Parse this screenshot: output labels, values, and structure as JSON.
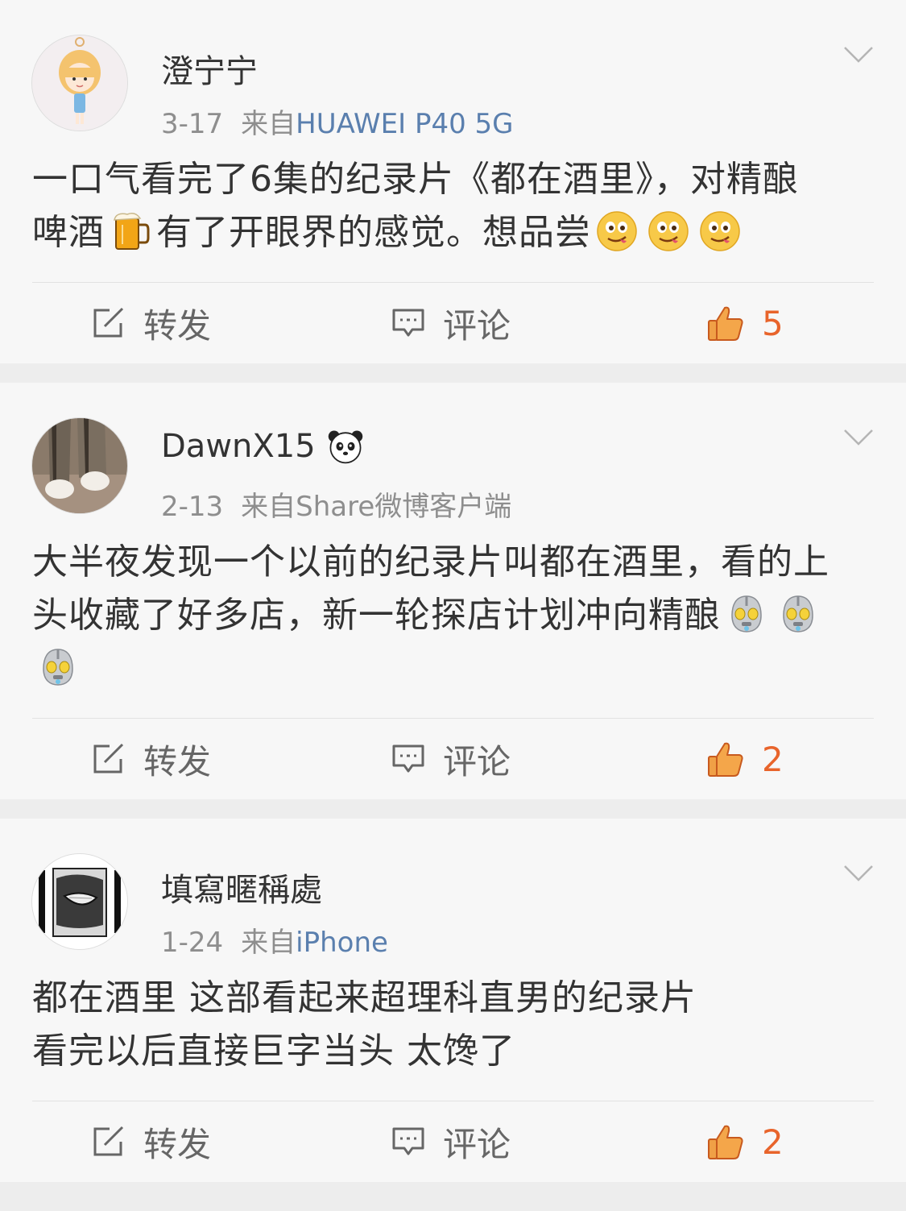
{
  "colors": {
    "background": "#ededed",
    "card": "#f7f7f7",
    "source_link": "#5a7fae",
    "like_accent": "#e8642b",
    "meta_gray": "#8e8e8e"
  },
  "posts": [
    {
      "user": {
        "name": "澄宁宁",
        "avatar": "cartoon-girl-avatar"
      },
      "date": "3-17",
      "source_prefix": "来自",
      "source": "HUAWEI P40 5G",
      "content_lines": [
        "一口气看完了6集的纪录片《都在酒里》，对精酿",
        "啤酒",
        "有了开眼界的感觉。想品尝"
      ],
      "emojis": [
        "beer-icon",
        "drool-face-icon",
        "drool-face-icon",
        "drool-face-icon"
      ],
      "actions": {
        "repost": "转发",
        "comment": "评论",
        "likes": "5"
      }
    },
    {
      "user": {
        "name": "DawnX15",
        "badge": "panda-badge-icon",
        "avatar": "cat-paw-avatar"
      },
      "date": "2-13",
      "source_prefix": "来自",
      "source": "Share微博客户端",
      "content_lines": [
        "大半夜发现一个以前的纪录片叫都在酒里，看的上",
        "头收藏了好多店，新一轮探店计划冲向精酿"
      ],
      "emojis": [
        "ultraman-icon",
        "ultraman-icon",
        "ultraman-icon"
      ],
      "actions": {
        "repost": "转发",
        "comment": "评论",
        "likes": "2"
      }
    },
    {
      "user": {
        "name": "填寫暱稱處",
        "avatar": "bw-smile-avatar"
      },
      "date": "1-24",
      "source_prefix": "来自",
      "source": "iPhone",
      "content_lines": [
        "都在酒里 这部看起来超理科直男的纪录片",
        "看完以后直接巨字当头 太馋了"
      ],
      "actions": {
        "repost": "转发",
        "comment": "评论",
        "likes": "2"
      }
    }
  ]
}
